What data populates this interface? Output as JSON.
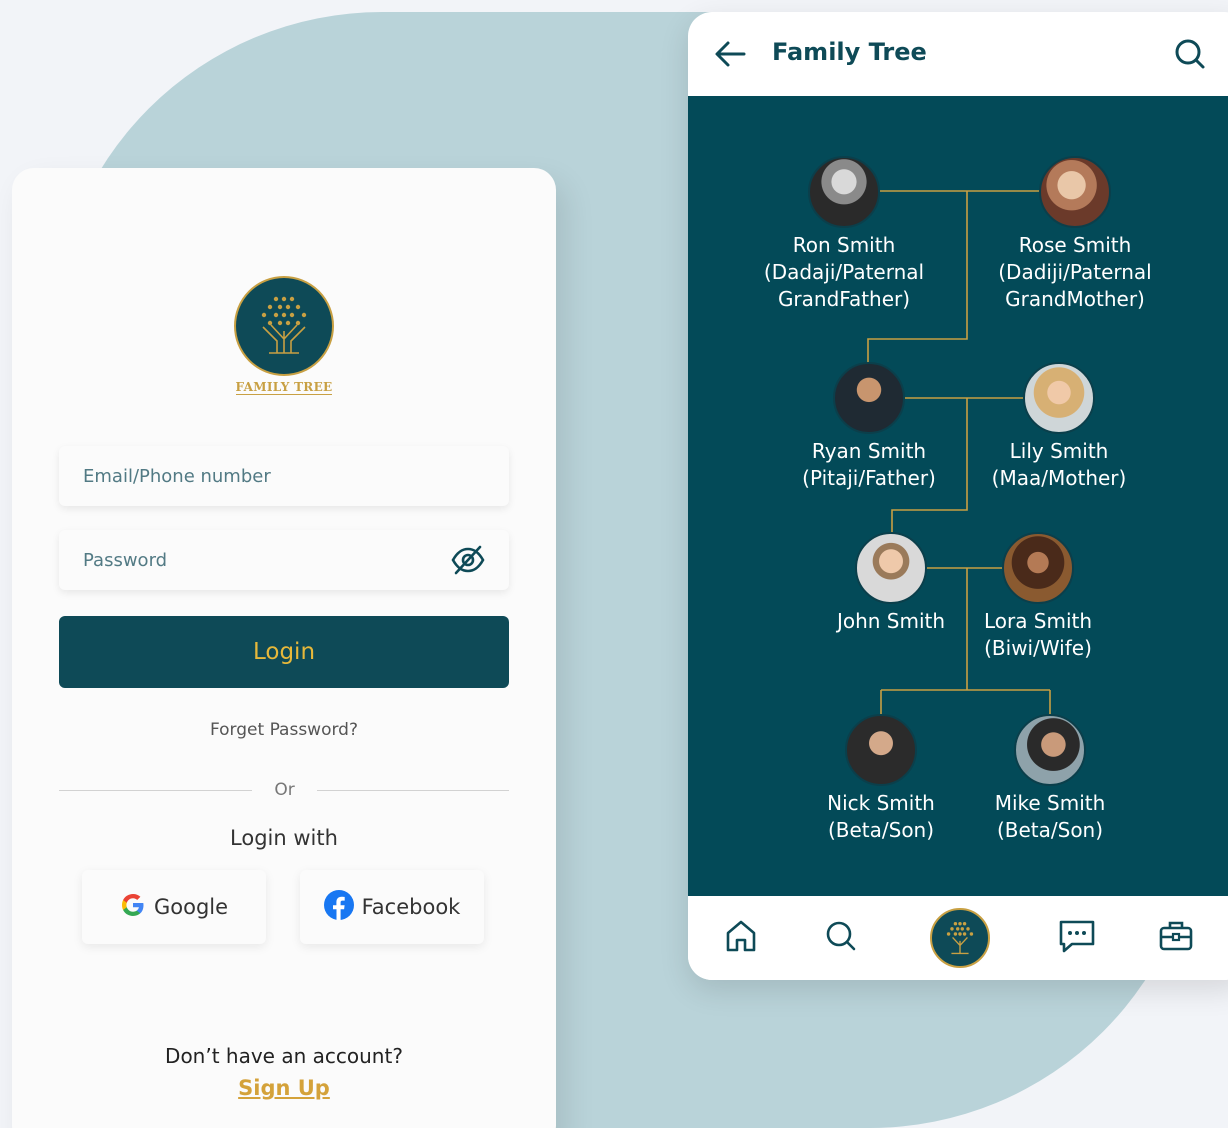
{
  "login": {
    "logo_text": "FAMILY TREE",
    "email_placeholder": "Email/Phone number",
    "password_placeholder": "Password",
    "login_label": "Login",
    "forgot_label": "Forget Password?",
    "or_label": "Or",
    "login_with_label": "Login with",
    "google_label": "Google",
    "facebook_label": "Facebook",
    "no_account_text": "Don’t have an account?",
    "signup_label": "Sign Up"
  },
  "tree_screen": {
    "title": "Family Tree",
    "people": [
      {
        "name": "Ron Smith",
        "relation": "(Dadaji/Paternal GrandFather)"
      },
      {
        "name": "Rose Smith",
        "relation": "(Dadiji/Paternal GrandMother)"
      },
      {
        "name": "Ryan Smith",
        "relation": "(Pitaji/Father)"
      },
      {
        "name": "Lily Smith",
        "relation": "(Maa/Mother)"
      },
      {
        "name": "John Smith",
        "relation": ""
      },
      {
        "name": "Lora Smith",
        "relation": "(Biwi/Wife)"
      },
      {
        "name": "Nick Smith",
        "relation": "(Beta/Son)"
      },
      {
        "name": "Mike Smith",
        "relation": "(Beta/Son)"
      }
    ],
    "nav": [
      "home-icon",
      "search-icon",
      "family-tree-logo-icon",
      "chat-icon",
      "briefcase-icon"
    ]
  },
  "colors": {
    "primary": "#0e4a57",
    "tree_bg": "#034a58",
    "accent_gold": "#c8a043",
    "button_text": "#e6b83a",
    "background_blob": "#b9d3d9"
  }
}
